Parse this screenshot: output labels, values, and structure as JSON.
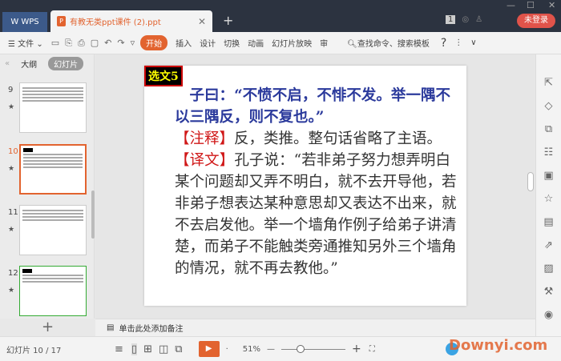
{
  "app": {
    "brand": "WPS",
    "doc_tab": "有教无类ppt课件 (2).ppt",
    "login": "未登录",
    "badge": "1"
  },
  "toolbar": {
    "file": "文件",
    "tabs": [
      "开始",
      "插入",
      "设计",
      "切换",
      "动画",
      "幻灯片放映",
      "审"
    ],
    "search": "查找命令、搜索模板",
    "help": "?"
  },
  "left_panel": {
    "tabs": [
      "大纲",
      "幻灯片"
    ],
    "thumbs": [
      {
        "num": "9"
      },
      {
        "num": "10"
      },
      {
        "num": "11"
      },
      {
        "num": "12"
      }
    ]
  },
  "slide": {
    "label": "选文5",
    "lines": [
      {
        "text": "　子曰：“不愤不启，不悱不发。举一隅不",
        "style": "blue"
      },
      {
        "text": "以三隅反，则不复也。”",
        "style": "blue"
      },
      {
        "tag": "【注释】",
        "text": "反，类推。整句话省略了主语。"
      },
      {
        "tag": "【译文】",
        "text": "孔子说：“若非弟子努力想弄明白"
      },
      {
        "text": "某个问题却又弄不明白，就不去开导他，若"
      },
      {
        "text": "非弟子想表达某种意思却又表达不出来，就"
      },
      {
        "text": "不去启发他。举一个墙角作例子给弟子讲清"
      },
      {
        "text": "楚，而弟子不能触类旁通推知另外三个墙角"
      },
      {
        "text": "的情况，就不再去教他。”"
      }
    ]
  },
  "notes": {
    "placeholder": "单击此处添加备注"
  },
  "status": {
    "slide_indicator": "幻灯片 10 / 17",
    "zoom": "51%",
    "zoom_fraction": 0.3
  },
  "watermark": "Downyi.com",
  "colors": {
    "accent": "#e2632f",
    "title_bar": "#2c3340",
    "slide_blue": "#2b3a9c",
    "slide_red": "#d01818"
  }
}
